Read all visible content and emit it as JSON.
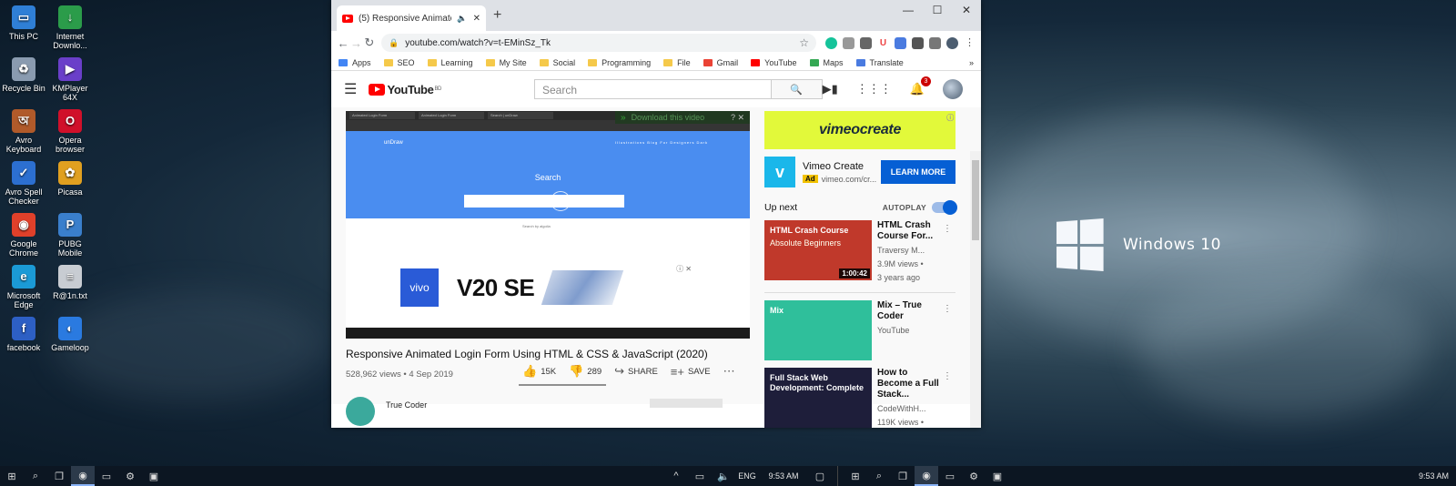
{
  "desktop": {
    "icons": [
      {
        "label": "This PC",
        "glyph": "▭",
        "color": "#2f7fd6"
      },
      {
        "label": "Internet Downlo...",
        "glyph": "↓",
        "color": "#2b9c4a"
      },
      {
        "label": "Recycle Bin",
        "glyph": "♻",
        "color": "#8a9bb0"
      },
      {
        "label": "KMPlayer 64X",
        "glyph": "▶",
        "color": "#6a3fc9"
      },
      {
        "label": "Avro Keyboard",
        "glyph": "অ",
        "color": "#b05a2a"
      },
      {
        "label": "Opera browser",
        "glyph": "O",
        "color": "#d0102a"
      },
      {
        "label": "Avro Spell Checker",
        "glyph": "✓",
        "color": "#2c6fd0"
      },
      {
        "label": "Picasa",
        "glyph": "✿",
        "color": "#e0a020"
      },
      {
        "label": "Google Chrome",
        "glyph": "◉",
        "color": "#e0402a"
      },
      {
        "label": "PUBG Mobile",
        "glyph": "P",
        "color": "#3a7fcc"
      },
      {
        "label": "Microsoft Edge",
        "glyph": "e",
        "color": "#1b9ad6"
      },
      {
        "label": "R@1n.txt",
        "glyph": "≡",
        "color": "#c8ccd2"
      },
      {
        "label": "facebook",
        "glyph": "f",
        "color": "#2d5fc4"
      },
      {
        "label": "Gameloop",
        "glyph": "◐",
        "color": "#2a7ae0"
      }
    ],
    "brand_text": "Windows 10"
  },
  "taskbar": {
    "left": {
      "time": "9:53 AM",
      "lang": "ENG"
    },
    "right": {
      "time": "9:53 AM"
    }
  },
  "browser": {
    "tab_title": "(5) Responsive Animated Lo...",
    "url": "youtube.com/watch?v=t-EMinSz_Tk",
    "bookmarks": [
      "Apps",
      "SEO",
      "Learning",
      "My Site",
      "Social",
      "Programming",
      "File",
      "Gmail",
      "YouTube",
      "Maps",
      "Translate"
    ]
  },
  "youtube": {
    "logo_text": "YouTube",
    "logo_region": "BD",
    "search_placeholder": "Search",
    "notification_count": "3",
    "download_bar": "Download this video",
    "video": {
      "title": "Responsive Animated Login Form Using HTML & CSS & JavaScript (2020)",
      "meta": "528,962 views • 4 Sep 2019",
      "likes": "15K",
      "dislikes": "289",
      "share": "SHARE",
      "save": "SAVE",
      "channel": "True Coder"
    },
    "inner_page": {
      "brand": "unDraw",
      "menu": "Illustrations  Blog  For Designers  Dark",
      "search_title": "Search",
      "algolia": "Search by algolia",
      "ad_brand": "vivo",
      "ad_model": "V20 SE"
    },
    "sidebar": {
      "ad_banner": "vimeocreate",
      "ad_title": "Vimeo Create",
      "ad_tag": "Ad",
      "ad_domain": "vimeo.com/cr...",
      "ad_cta": "LEARN MORE",
      "up_next": "Up next",
      "autoplay": "AUTOPLAY",
      "autoplay_on": true,
      "videos": [
        {
          "title": "HTML Crash Course For...",
          "channel": "Traversy M...",
          "meta": "3.9M views •",
          "meta2": "3 years ago",
          "duration": "1:00:42",
          "thumb_text": "HTML Crash Course",
          "thumb_sub": "Absolute Beginners",
          "bg": "#c0392b"
        },
        {
          "title": "Mix – True Coder",
          "channel": "YouTube",
          "meta": "",
          "meta2": "",
          "duration": "",
          "thumb_text": "Mix",
          "thumb_sub": "",
          "bg": "#2fbf9b"
        },
        {
          "title": "How to Become a Full Stack...",
          "channel": "CodeWithH...",
          "meta": "119K views •",
          "meta2": "",
          "duration": "",
          "thumb_text": "Full Stack Web Development: Complete",
          "thumb_sub": "",
          "bg": "#1e1e3a"
        }
      ]
    }
  }
}
